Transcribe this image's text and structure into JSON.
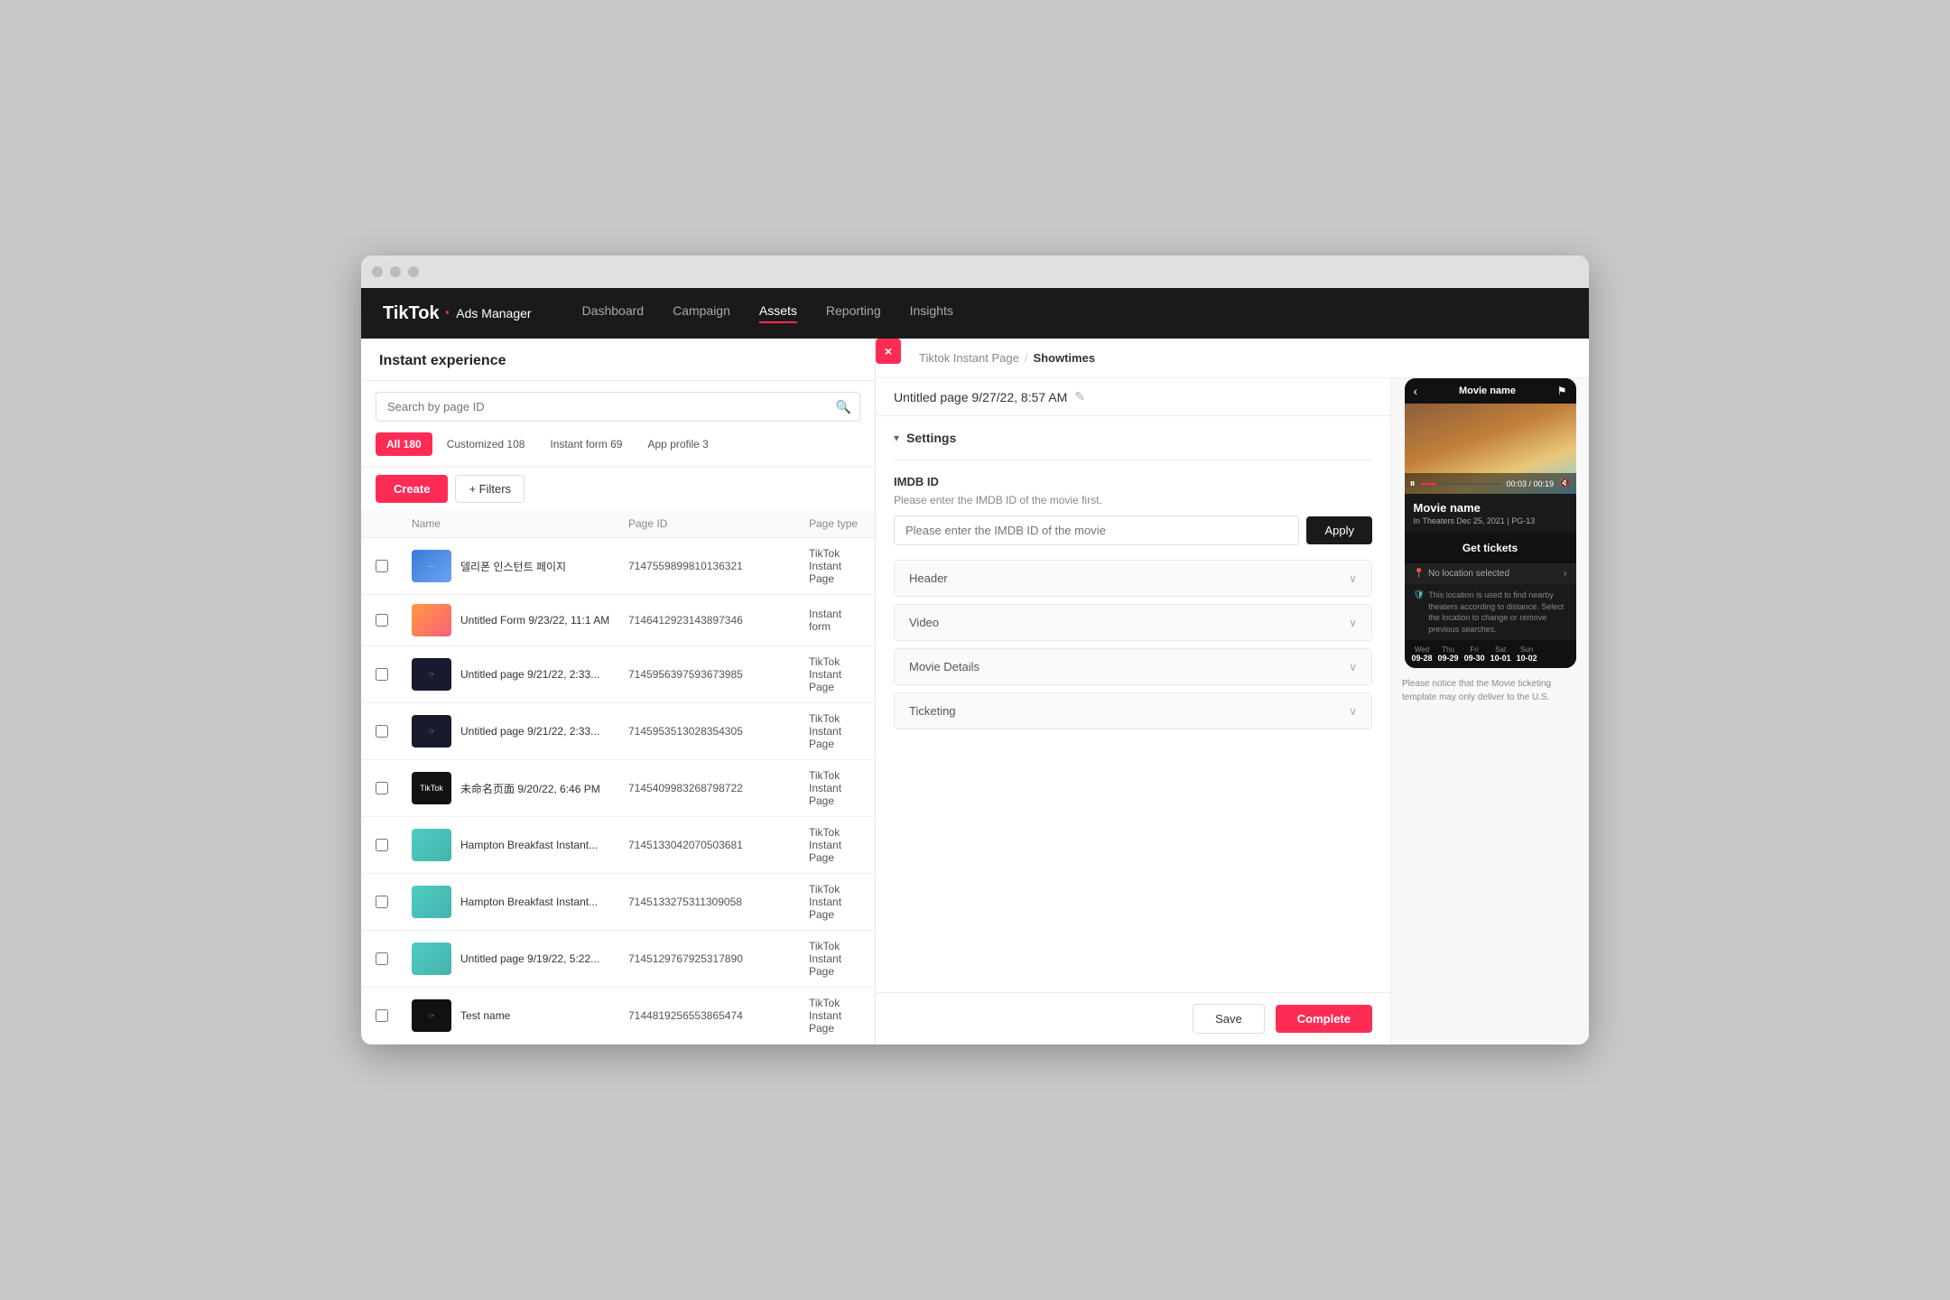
{
  "window": {
    "title": "TikTok Ads Manager"
  },
  "topnav": {
    "logo": "TikTok",
    "logo_dot": "·",
    "logo_sub": "Ads Manager",
    "items": [
      {
        "label": "Dashboard",
        "active": false
      },
      {
        "label": "Campaign",
        "active": false
      },
      {
        "label": "Assets",
        "active": true
      },
      {
        "label": "Reporting",
        "active": false
      },
      {
        "label": "Insights",
        "active": false
      }
    ]
  },
  "sidebar": {
    "title": "Instant experience",
    "search_placeholder": "Search by page ID",
    "tabs": [
      {
        "label": "All 180",
        "active": true
      },
      {
        "label": "Customized 108",
        "active": false
      },
      {
        "label": "Instant form 69",
        "active": false
      },
      {
        "label": "App profile 3",
        "active": false
      }
    ],
    "create_label": "Create",
    "filter_label": "+ Filters",
    "table": {
      "headers": [
        "",
        "Name",
        "Page ID",
        "Page type"
      ],
      "rows": [
        {
          "name": "델리폰 인스턴트 페이지",
          "page_id": "7147559899810136321",
          "page_type": "TikTok Instant Page",
          "thumb_color": "blue"
        },
        {
          "name": "Untitled Form 9/23/22, 11:1 AM",
          "page_id": "7146412923143897346",
          "page_type": "Instant form",
          "thumb_color": "orange"
        },
        {
          "name": "Untitled page 9/21/22, 2:33...",
          "page_id": "7145956397593673985",
          "page_type": "TikTok Instant Page",
          "thumb_color": "dark"
        },
        {
          "name": "Untitled page 9/21/22, 2:33...",
          "page_id": "7145953513028354305",
          "page_type": "TikTok Instant Page",
          "thumb_color": "dark"
        },
        {
          "name": "未命名页面 9/20/22, 6:46 PM",
          "page_id": "7145409983268798722",
          "page_type": "TikTok Instant Page",
          "thumb_color": "tiktok"
        },
        {
          "name": "Hampton Breakfast Instant...",
          "page_id": "7145133042070503681",
          "page_type": "TikTok Instant Page",
          "thumb_color": "teal"
        },
        {
          "name": "Hampton Breakfast Instant...",
          "page_id": "7145133275311309058",
          "page_type": "TikTok Instant Page",
          "thumb_color": "teal"
        },
        {
          "name": "Untitled page 9/19/22, 5:22...",
          "page_id": "7145129767925317890",
          "page_type": "TikTok Instant Page",
          "thumb_color": "teal"
        },
        {
          "name": "Test name",
          "page_id": "7144819256553865474",
          "page_type": "TikTok Instant Page",
          "thumb_color": "dark"
        }
      ]
    }
  },
  "panel": {
    "close_icon": "×",
    "breadcrumb_parent": "Tiktok Instant Page",
    "breadcrumb_sep": "/",
    "breadcrumb_current": "Showtimes",
    "page_title": "Untitled page 9/27/22, 8:57 AM",
    "edit_icon": "✎",
    "settings_label": "Settings",
    "settings_arrow": "▾",
    "imdb": {
      "label": "IMDB ID",
      "hint": "Please enter the IMDB ID of the movie first.",
      "placeholder": "Please enter the IMDB ID of the movie",
      "apply_label": "Apply"
    },
    "accordions": [
      {
        "title": "Header",
        "open": false
      },
      {
        "title": "Video",
        "open": false
      },
      {
        "title": "Movie Details",
        "open": false
      },
      {
        "title": "Ticketing",
        "open": false
      }
    ]
  },
  "preview": {
    "movie_title": "Movie name",
    "movie_meta": "In Theaters  Dec 25, 2021  |  PG-13",
    "get_tickets": "Get tickets",
    "location_text": "No location selected",
    "notice": "This location is used to find nearby theaters according to distance. Select the location to change or remove previous searches.",
    "dates": [
      {
        "day": "Wed",
        "num": "09-28",
        "active": false
      },
      {
        "day": "Thu",
        "num": "09-29",
        "active": false
      },
      {
        "day": "Fri",
        "num": "09-30",
        "active": false
      },
      {
        "day": "Sat",
        "num": "10-01",
        "active": false
      },
      {
        "day": "Sun",
        "num": "10-02",
        "active": false
      }
    ],
    "video_time": "00:03 / 00:19",
    "bottom_notice": "Please notice that the Movie ticketing template may only deliver to the U.S."
  },
  "footer": {
    "save_label": "Save",
    "complete_label": "Complete"
  }
}
